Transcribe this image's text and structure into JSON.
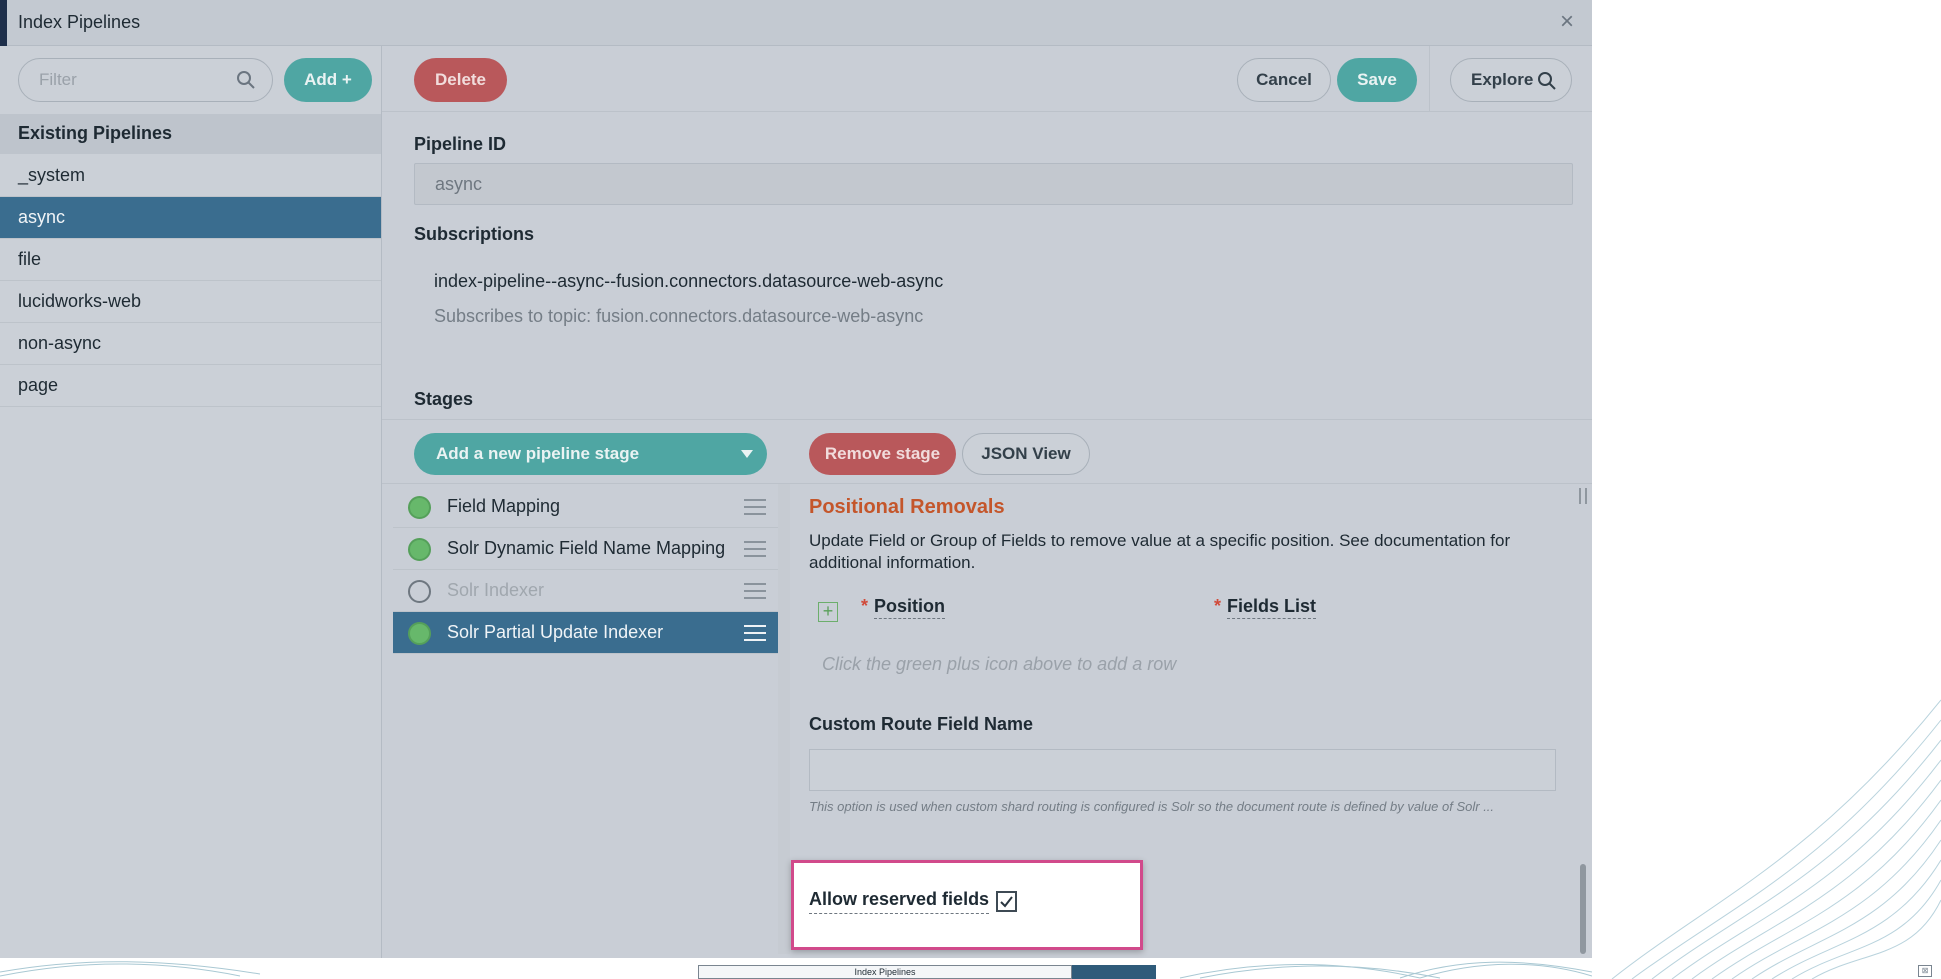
{
  "modal": {
    "title": "Index Pipelines",
    "close_glyph": "×"
  },
  "sidebar": {
    "filter_placeholder": "Filter",
    "add_label": "Add +",
    "existing_header": "Existing Pipelines",
    "pipelines": [
      "_system",
      "async",
      "file",
      "lucidworks-web",
      "non-async",
      "page"
    ],
    "selected": "async"
  },
  "toolbar": {
    "delete_label": "Delete",
    "cancel_label": "Cancel",
    "save_label": "Save",
    "explore_label": "Explore"
  },
  "pipeline": {
    "id_label": "Pipeline ID",
    "id_value": "async",
    "subscriptions_label": "Subscriptions",
    "subscription_name": "index-pipeline--async--fusion.connectors.datasource-web-async",
    "subscription_topic": "Subscribes to topic: fusion.connectors.datasource-web-async"
  },
  "stages": {
    "label": "Stages",
    "add_label": "Add a new pipeline stage",
    "remove_label": "Remove stage",
    "json_label": "JSON View",
    "items": [
      {
        "name": "Field Mapping",
        "enabled": true
      },
      {
        "name": "Solr Dynamic Field Name Mapping",
        "enabled": true
      },
      {
        "name": "Solr Indexer",
        "enabled": false
      },
      {
        "name": "Solr Partial Update Indexer",
        "enabled": true
      }
    ],
    "selected": "Solr Partial Update Indexer"
  },
  "detail": {
    "section_title": "Positional Removals",
    "description": "Update Field or Group of Fields to remove value at a specific position. See documentation for additional information.",
    "required_mark": "*",
    "col_position": "Position",
    "col_fields_list": "Fields List",
    "empty_hint": "Click the green plus icon above to add a row",
    "custom_route_label": "Custom Route Field Name",
    "custom_route_value": "",
    "custom_route_help": "This option is used when custom shard routing is configured is Solr so the document route is defined by value of Solr ...",
    "allow_reserved_label": "Allow reserved fields",
    "allow_reserved_checked": true
  },
  "taskbar": {
    "window_label": "Index Pipelines"
  },
  "colors": {
    "teal_button": "#4fa6a3",
    "red_button": "#b9585b",
    "selected_row": "#3a6d8f",
    "section_title": "#c4562b",
    "highlight_border": "#d14a8b"
  }
}
